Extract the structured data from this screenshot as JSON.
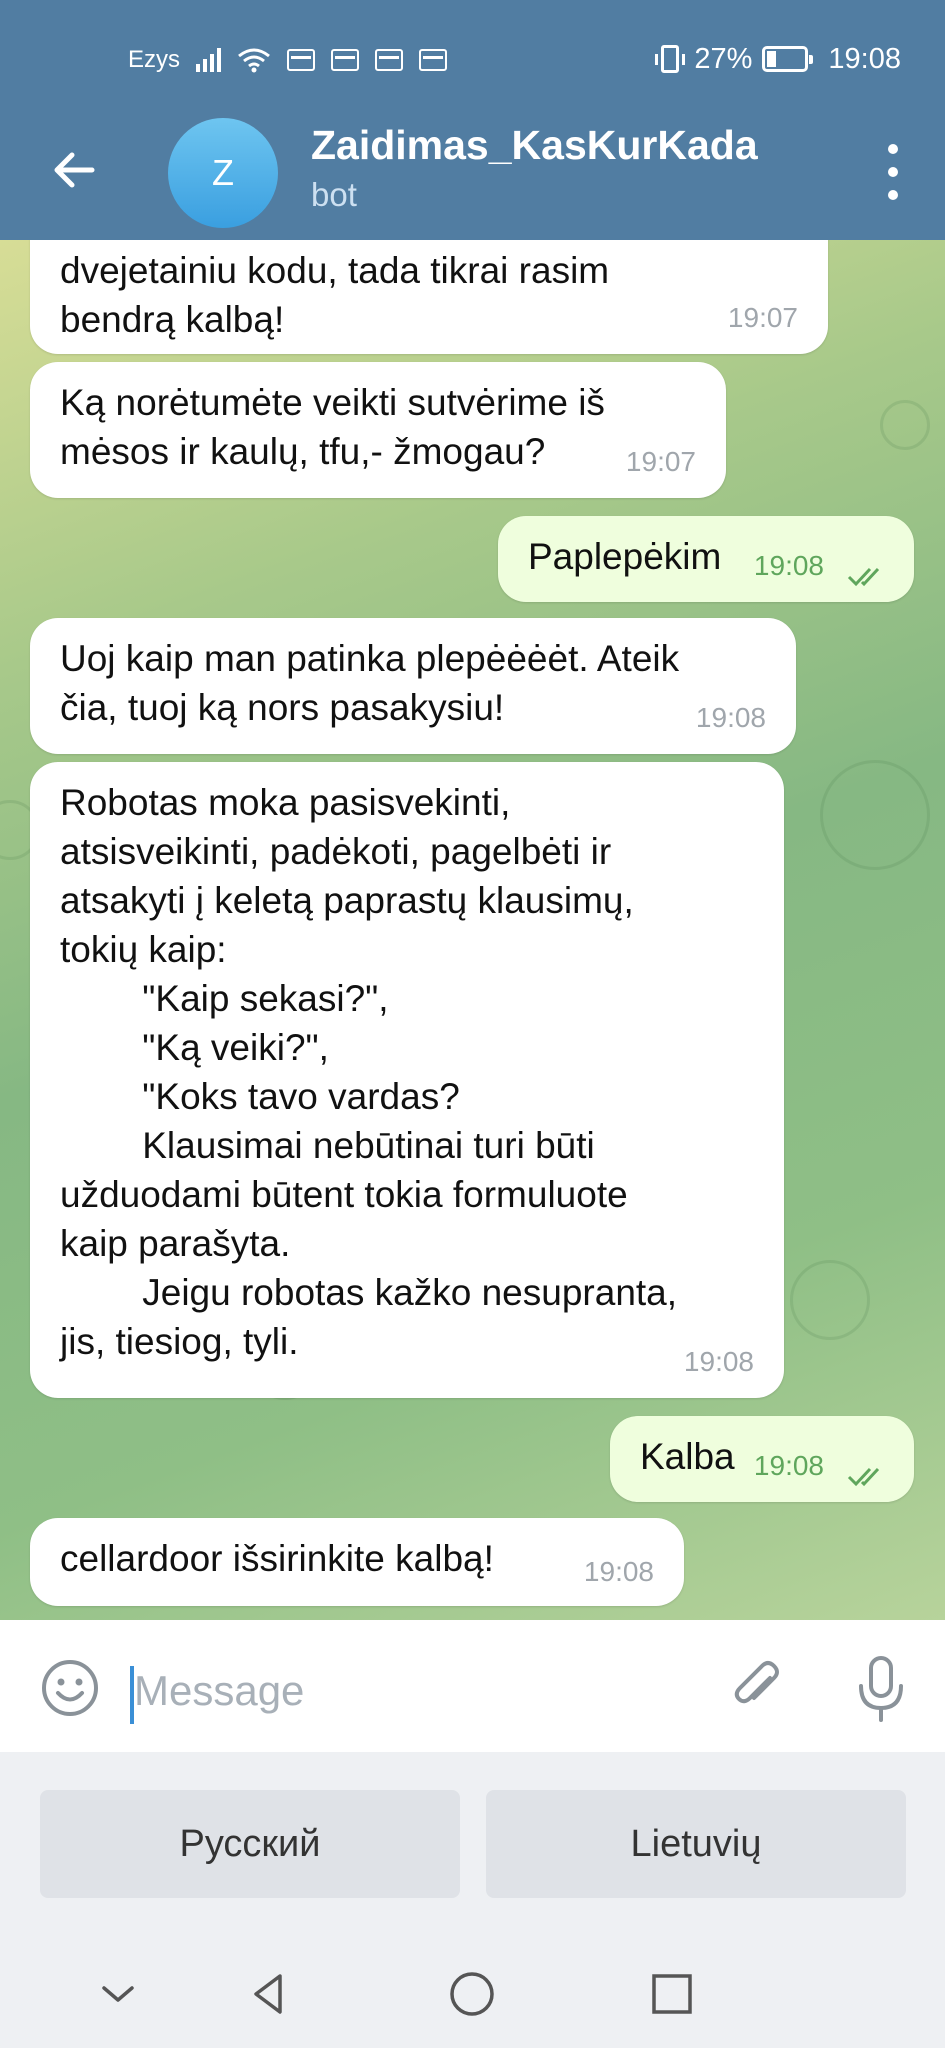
{
  "status": {
    "carrier": "Ezys",
    "battery": "27%",
    "time": "19:08"
  },
  "header": {
    "avatar_letter": "Z",
    "title": "Zaidimas_KasKurKada",
    "subtitle": "bot"
  },
  "messages": [
    {
      "dir": "in",
      "text": "dvejetainiu kodu, tada tikrai rasim\nbendrą kalbą!",
      "time": "19:07"
    },
    {
      "dir": "in",
      "text": "Ką norėtumėte veikti sutvėrime iš\nmėsos ir kaulų, tfu,- žmogau?",
      "time": "19:07"
    },
    {
      "dir": "out",
      "text": "Paplepėkim",
      "time": "19:08"
    },
    {
      "dir": "in",
      "text": "Uoj kaip man patinka plepėėėėt. Ateik\nčia, tuoj ką nors pasakysiu!",
      "time": "19:08"
    },
    {
      "dir": "in",
      "text": "Robotas moka pasisvekinti,\natsisveikinti, padėkoti, pagelbėti ir\natsakyti į keletą paprastų klausimų,\ntokių kaip:\n        \"Kaip sekasi?\",\n        \"Ką veiki?\",\n        \"Koks tavo vardas?\n        Klausimai nebūtinai turi būti\nužduodami būtent tokia formuluote\nkaip parašyta.\n        Jeigu robotas kažko nesupranta,\njis, tiesiog, tyli.",
      "time": "19:08"
    },
    {
      "dir": "out",
      "text": "Kalba",
      "time": "19:08"
    },
    {
      "dir": "in",
      "text": "cellardoor išsirinkite kalbą!",
      "time": "19:08"
    }
  ],
  "input": {
    "placeholder": "Message"
  },
  "keyboard": {
    "buttons": [
      "Русский",
      "Lietuvių"
    ]
  },
  "icons": [
    "back-arrow-icon",
    "more-vertical-icon",
    "emoji-icon",
    "attach-icon",
    "microphone-icon",
    "double-check-icon",
    "nav-collapse-icon",
    "nav-back-icon",
    "nav-home-icon",
    "nav-recents-icon"
  ],
  "colors": {
    "header": "#517da2",
    "incoming_bubble": "#ffffff",
    "outgoing_bubble": "#effedd",
    "outgoing_time": "#5fa65c"
  }
}
